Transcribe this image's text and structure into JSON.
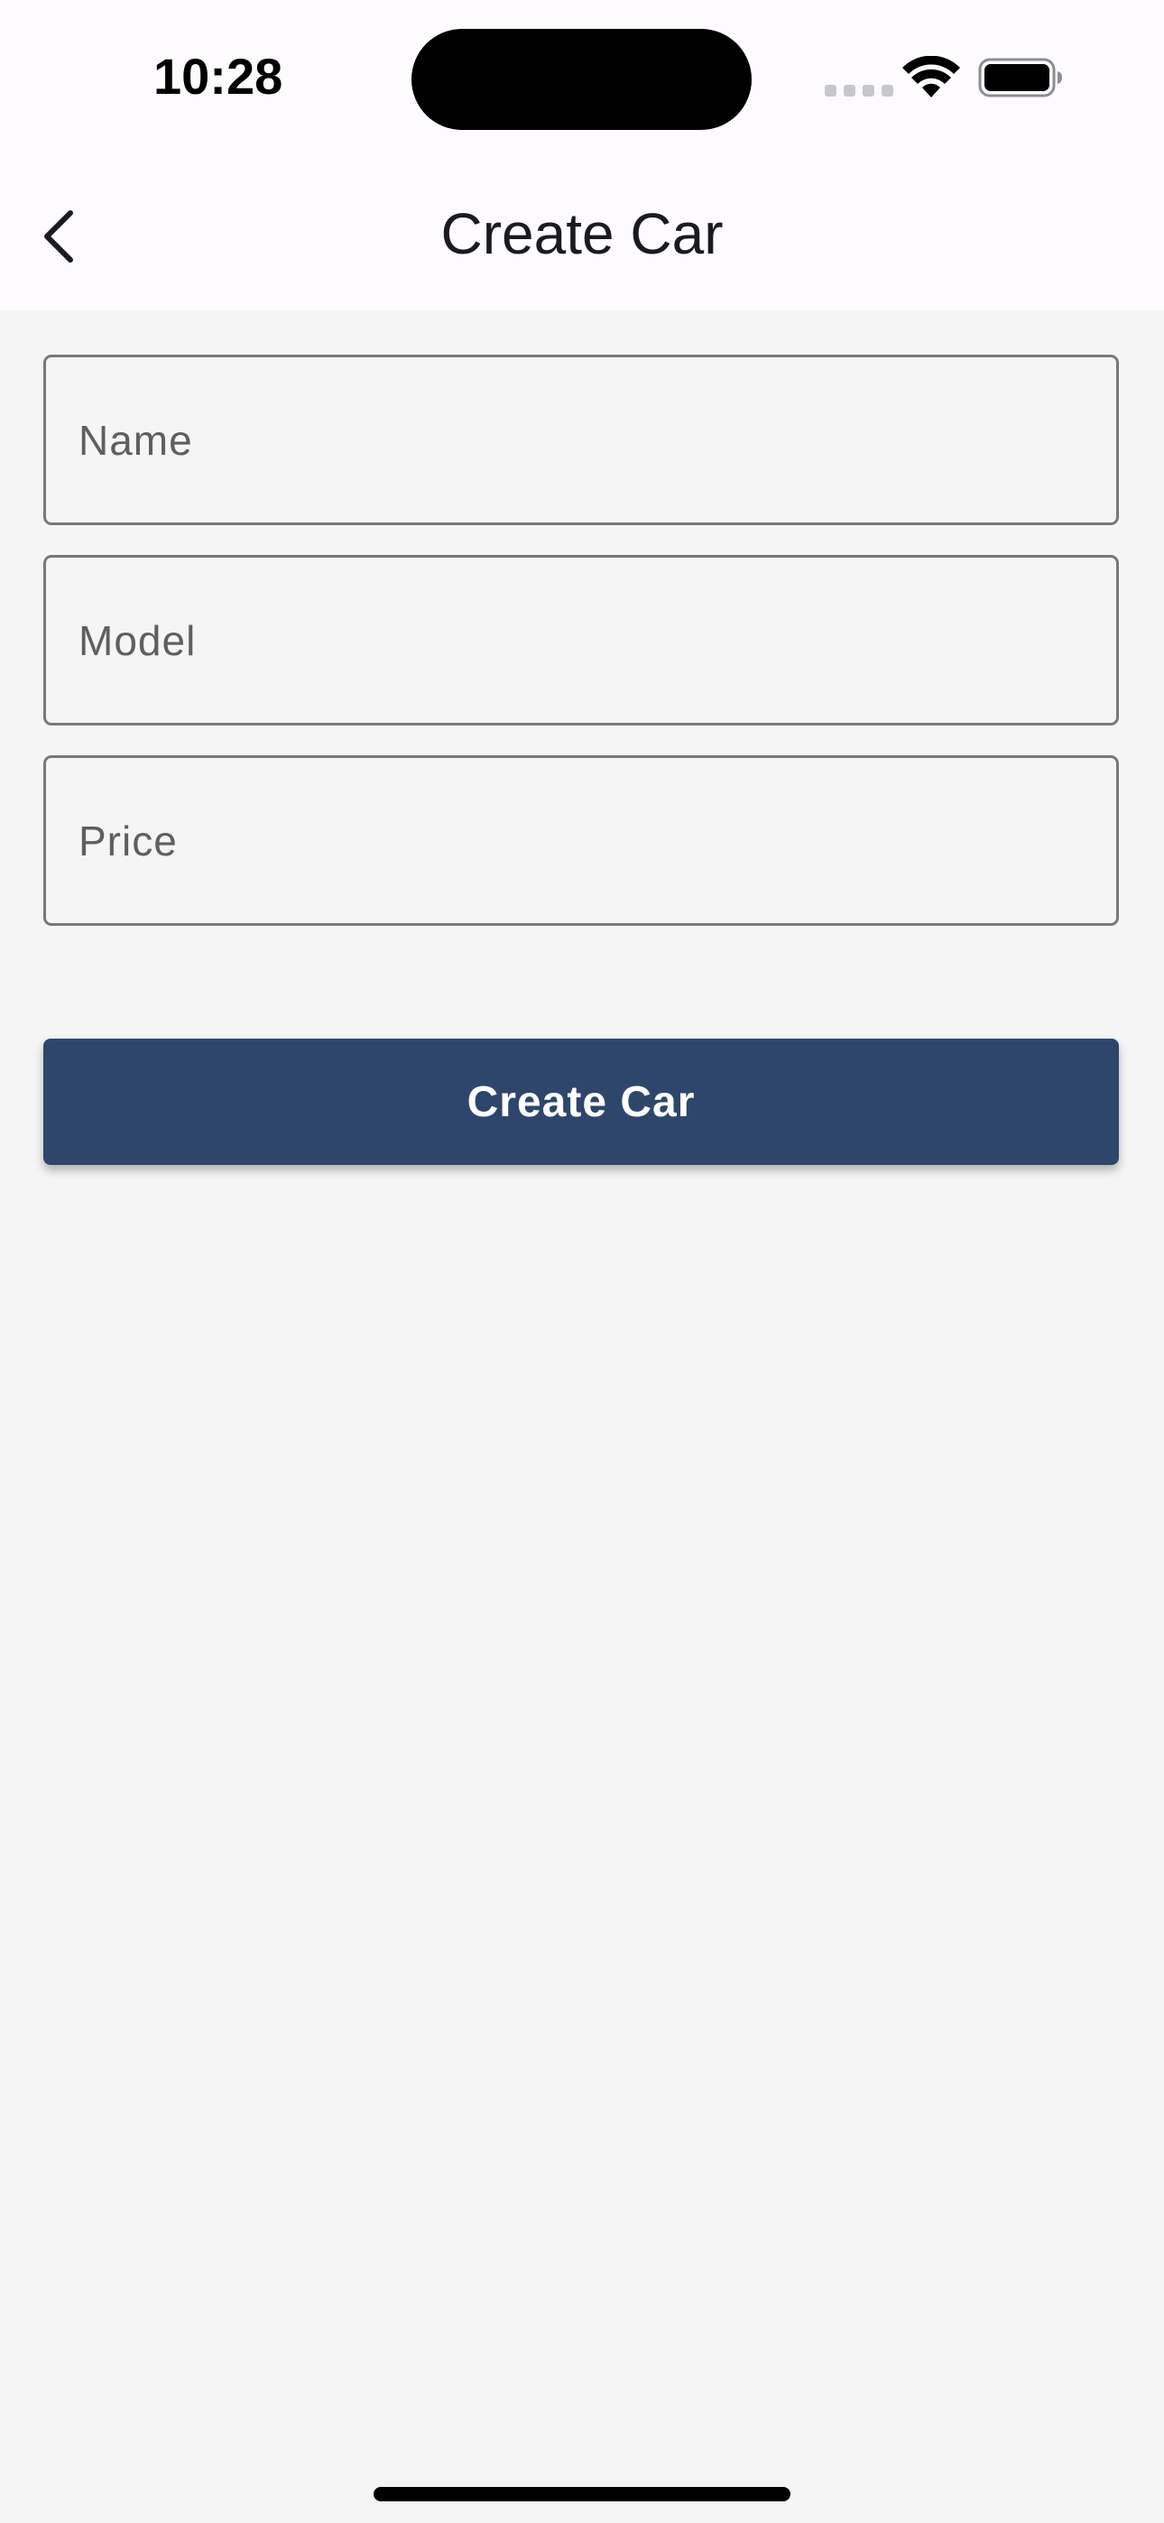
{
  "status_bar": {
    "time": "10:28",
    "icons": [
      "signal-dots-icon",
      "wifi-icon",
      "battery-icon"
    ]
  },
  "app_bar": {
    "back_icon": "chevron-left-icon",
    "title": "Create Car"
  },
  "form": {
    "name_placeholder": "Name",
    "model_placeholder": "Model",
    "price_placeholder": "Price",
    "submit_label": "Create Car"
  },
  "colors": {
    "background": "#f4f5f4",
    "app_bar": "#fdfbfe",
    "button": "#2e466b",
    "field_border": "#787878"
  }
}
